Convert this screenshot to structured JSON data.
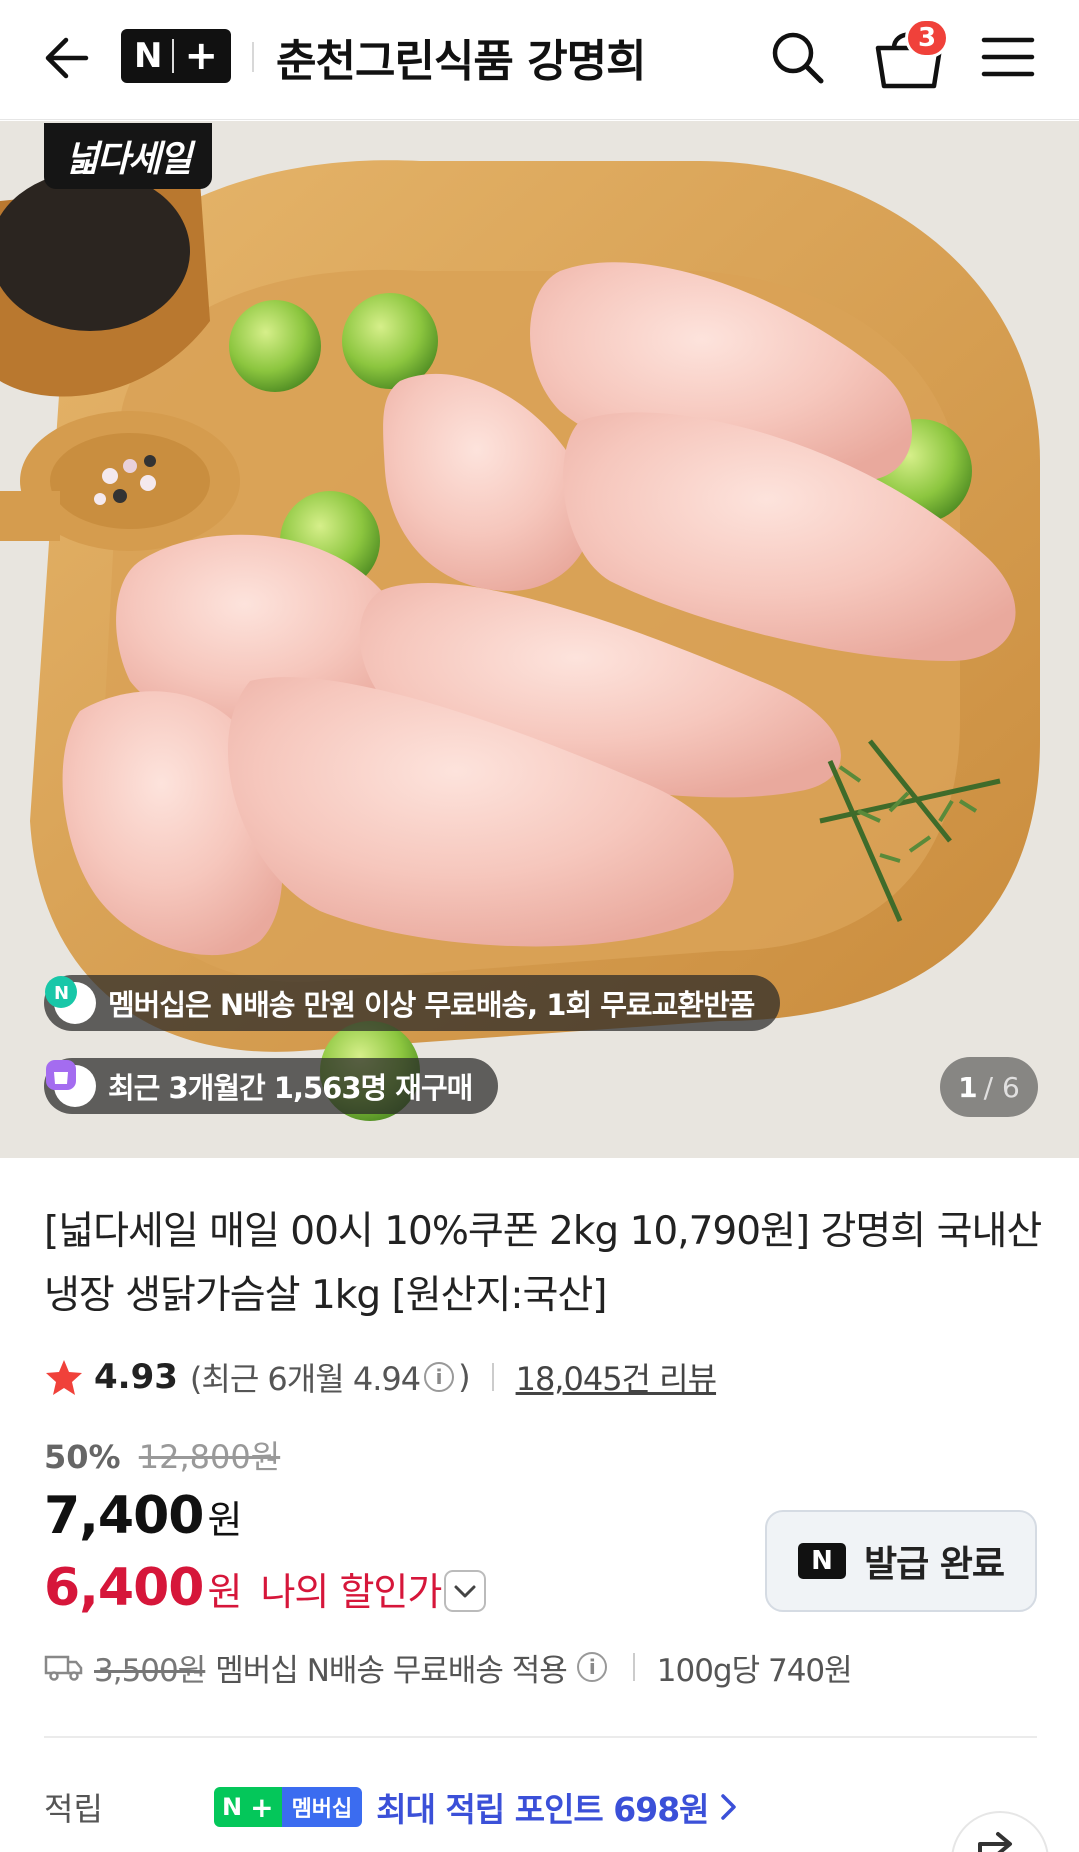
{
  "header": {
    "logo_n": "N",
    "logo_plus": "+",
    "store_name": "춘천그린식품 강명희",
    "cart_count": "3"
  },
  "hero": {
    "sale_badge": "넓다세일",
    "membership_notice": "멤버십은 N배송 만원 이상 무료배송, 1회 무료교환반품",
    "repurchase_notice": "최근 3개월간 1,563명 재구매",
    "page_current": "1",
    "page_total": "/ 6"
  },
  "product": {
    "title": "[넓다세일 매일 00시 10%쿠폰 2kg 10,790원] 강명희 국내산 냉장 생닭가슴살 1kg [원산지:국산]",
    "rating": "4.93",
    "rating_recent_prefix": "(최근 6개월 4.94",
    "rating_recent_suffix": ")",
    "info_glyph": "i",
    "review_count": "18,045건 리뷰",
    "discount_rate": "50%",
    "original_price": "12,800원",
    "price": "7,400",
    "price_unit": "원",
    "my_price": "6,400",
    "my_price_unit": "원",
    "my_price_label": "나의 할인가",
    "coupon_logo": "N",
    "coupon_button": "발급 완료",
    "shipping_original": "3,500원",
    "shipping_text": "멤버십 N배송 무료배송 적용",
    "unit_price": "100g당 740원"
  },
  "points": {
    "label": "적립",
    "badge_n": "N",
    "badge_plus": "+",
    "badge_member": "멤버십",
    "text": "최대 적립 포인트 698원"
  },
  "colors": {
    "accent_red": "#d6163a",
    "badge_red": "#f0413a",
    "naver_green": "#04c75a",
    "point_blue": "#3b50d8"
  }
}
